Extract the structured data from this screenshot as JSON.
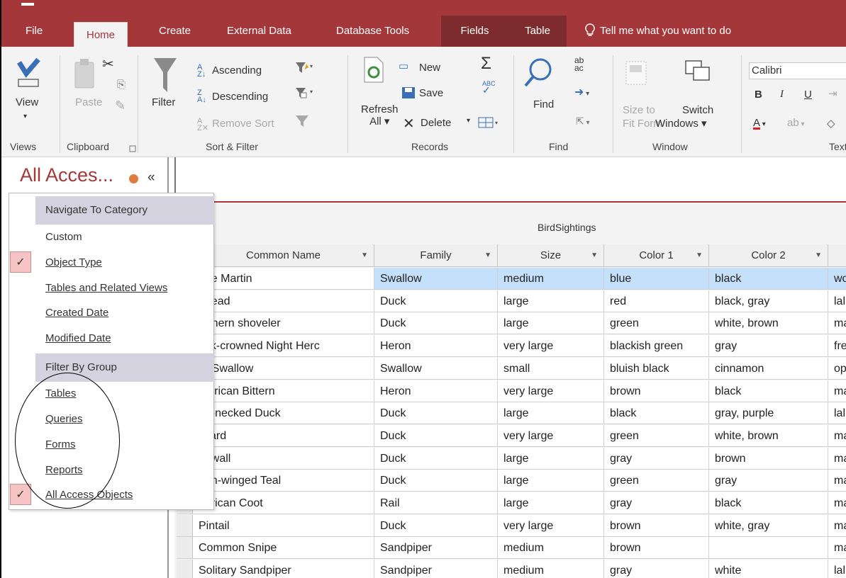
{
  "ribbon_tabs": [
    "File",
    "Home",
    "Create",
    "External Data",
    "Database Tools",
    "Fields",
    "Table"
  ],
  "tell_me": "Tell me what you want to do",
  "ribbon": {
    "views": {
      "view": "View",
      "group": "Views"
    },
    "clipboard": {
      "paste": "Paste",
      "group": "Clipboard"
    },
    "sort_filter": {
      "filter": "Filter",
      "ascending": "Ascending",
      "descending": "Descending",
      "remove_sort": "Remove Sort",
      "group": "Sort & Filter"
    },
    "records": {
      "refresh": "Refresh",
      "refresh_all": "All",
      "new": "New",
      "save": "Save",
      "delete": "Delete",
      "group": "Records"
    },
    "find": {
      "find": "Find",
      "group": "Find"
    },
    "window": {
      "size_to": "Size to",
      "fit_form": "Fit Form",
      "switch": "Switch",
      "windows": "Windows",
      "group": "Window"
    },
    "text": {
      "font": "Calibri",
      "bold": "B",
      "italic": "I",
      "underline": "U",
      "group": "Text"
    }
  },
  "nav": {
    "title": "All Acces...",
    "collapse": "«"
  },
  "menu": {
    "category_header": "Navigate To Category",
    "categories": [
      "Custom",
      "Object Type",
      "Tables and Related Views",
      "Created Date",
      "Modified Date"
    ],
    "group_header": "Filter By Group",
    "groups": [
      "Tables",
      "Queries",
      "Forms",
      "Reports",
      "All Access Objects"
    ],
    "checked": [
      "Object Type",
      "All Access Objects"
    ]
  },
  "table": {
    "caption": "BirdSightings",
    "columns": [
      "Common Name",
      "Family",
      "Size",
      "Color 1",
      "Color 2"
    ],
    "rows": [
      [
        "rple Martin",
        "Swallow",
        "medium",
        "blue",
        "black",
        "wo"
      ],
      [
        "dhead",
        "Duck",
        "large",
        "red",
        "black, gray",
        "lal"
      ],
      [
        "orthern shoveler",
        "Duck",
        "large",
        "green",
        "white, brown",
        "ma"
      ],
      [
        "ack-crowned Night Herc",
        "Heron",
        "very large",
        "blackish green",
        "gray",
        "fre"
      ],
      [
        "rn Swallow",
        "Swallow",
        "small",
        "bluish black",
        "cinnamon",
        "op"
      ],
      [
        "merican Bittern",
        "Heron",
        "very large",
        "brown",
        "black",
        "ma"
      ],
      [
        "ng-necked Duck",
        "Duck",
        "large",
        "black",
        "gray, purple",
        "lal"
      ],
      [
        "allard",
        "Duck",
        "very large",
        "green",
        "white, brown",
        "ma"
      ],
      [
        "adwall",
        "Duck",
        "large",
        "gray",
        "brown",
        "ma"
      ],
      [
        "een-winged Teal",
        "Duck",
        "large",
        "green",
        "gray",
        "ma"
      ],
      [
        "nerican Coot",
        "Rail",
        "large",
        "gray",
        "black",
        "ma"
      ],
      [
        "Pintail",
        "Duck",
        "very large",
        "brown",
        "white, gray",
        "ma"
      ],
      [
        "Common Snipe",
        "Sandpiper",
        "medium",
        "brown",
        "",
        "ma"
      ],
      [
        "Solitary Sandpiper",
        "Sandpiper",
        "medium",
        "gray",
        "white",
        "lal"
      ]
    ],
    "selected_row": 0
  },
  "colors": {
    "accent": "#a4373a",
    "selection": "#c5e0fa",
    "menu_header": "#d5d2df"
  }
}
